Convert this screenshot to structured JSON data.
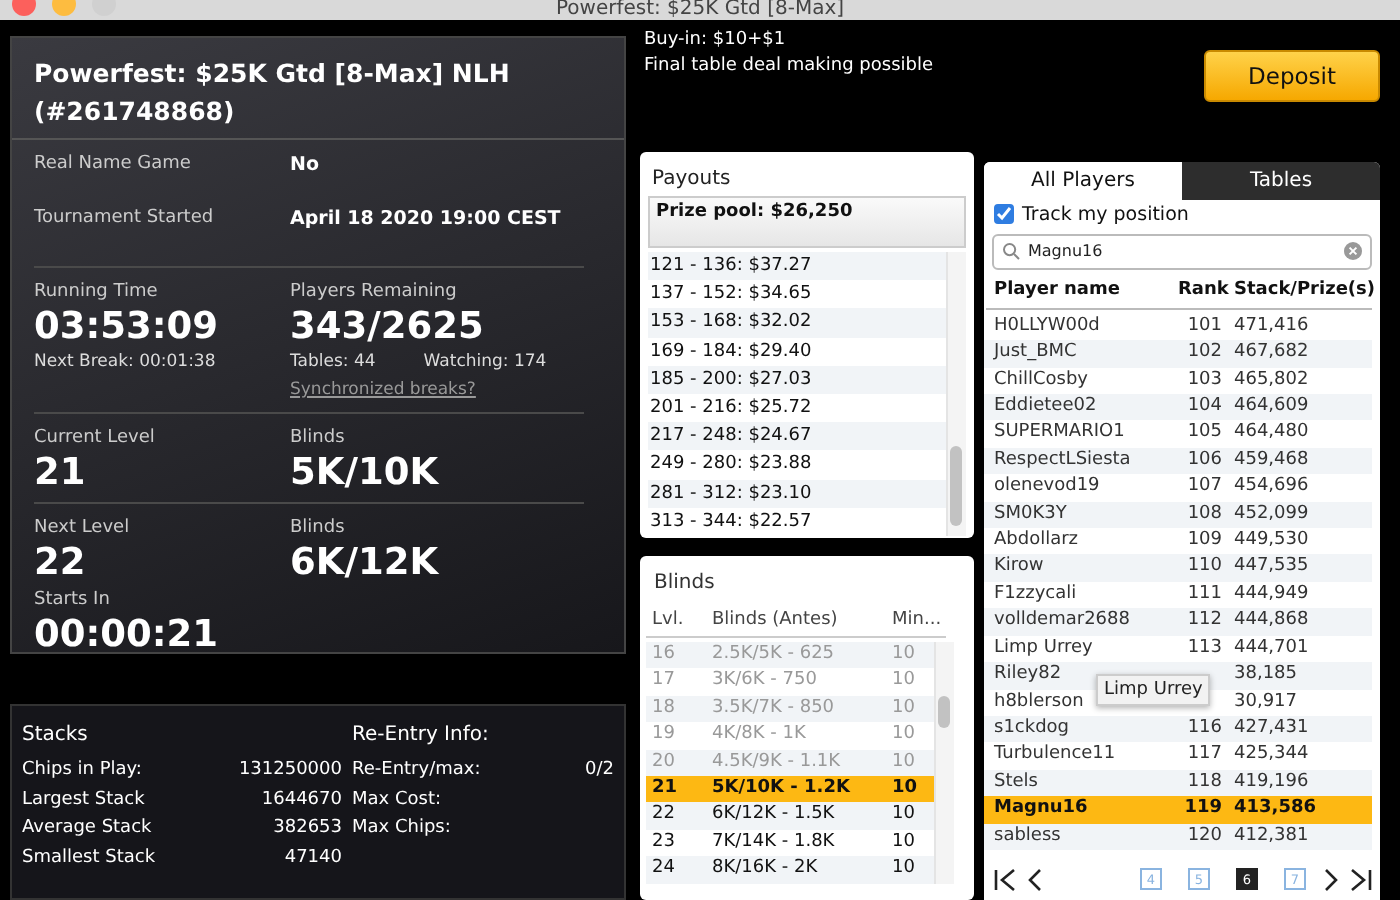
{
  "window": {
    "title": "Powerfest: $25K Gtd [8-Max]"
  },
  "tournament": {
    "title": "Powerfest: $25K Gtd [8-Max] NLH (#261748868)",
    "info": [
      {
        "label": "Real Name Game",
        "value": "No"
      },
      {
        "label": "Tournament Started",
        "value": "April 18 2020 19:00 CEST"
      }
    ],
    "running_time": {
      "label": "Running Time",
      "value": "03:53:09",
      "next_break": "Next Break: 00:01:38"
    },
    "players_remaining": {
      "label": "Players Remaining",
      "value": "343/2625",
      "tables": "Tables: 44",
      "watching": "Watching: 174",
      "link": "Synchronized breaks?"
    },
    "current_level": {
      "label": "Current Level",
      "value": "21",
      "blinds_label": "Blinds",
      "blinds": "5K/10K"
    },
    "next_level": {
      "label": "Next Level",
      "value": "22",
      "blinds_label": "Blinds",
      "blinds": "6K/12K"
    },
    "starts_in": {
      "label": "Starts In",
      "value": "00:00:21"
    }
  },
  "stacks": {
    "title": "Stacks",
    "rows": [
      {
        "label": "Chips in Play:",
        "value": "131250000"
      },
      {
        "label": "Largest Stack",
        "value": "1644670"
      },
      {
        "label": "Average Stack",
        "value": "382653"
      },
      {
        "label": "Smallest Stack",
        "value": "47140"
      }
    ]
  },
  "reentry": {
    "title": "Re-Entry Info:",
    "rows": [
      {
        "label": "Re-Entry/max:",
        "value": "0/2"
      },
      {
        "label": "Max Cost:"
      },
      {
        "label": "Max Chips:"
      }
    ]
  },
  "buy_in": "Buy-in: $10+$1",
  "deal_note": "Final table deal making possible",
  "deposit_button": "Deposit",
  "payouts": {
    "title": "Payouts",
    "prize_pool": "Prize pool: $26,250",
    "rows": [
      "121 - 136: $37.27",
      "137 - 152: $34.65",
      "153 - 168: $32.02",
      "169 - 184: $29.40",
      "185 - 200: $27.03",
      "201 - 216: $25.72",
      "217 - 248: $24.67",
      "249 - 280: $23.88",
      "281 - 312: $23.10",
      "313 - 344: $22.57"
    ]
  },
  "blinds": {
    "title": "Blinds",
    "columns": [
      "Lvl.",
      "Blinds (Antes)",
      "Min..."
    ],
    "rows": [
      {
        "level": "16",
        "blinds": "2.5K/5K - 625",
        "minutes": "10",
        "past": true,
        "selected": false
      },
      {
        "level": "17",
        "blinds": "3K/6K - 750",
        "minutes": "10",
        "past": true,
        "selected": false
      },
      {
        "level": "18",
        "blinds": "3.5K/7K - 850",
        "minutes": "10",
        "past": true,
        "selected": false
      },
      {
        "level": "19",
        "blinds": "4K/8K - 1K",
        "minutes": "10",
        "past": true,
        "selected": false
      },
      {
        "level": "20",
        "blinds": "4.5K/9K - 1.1K",
        "minutes": "10",
        "past": true,
        "selected": false
      },
      {
        "level": "21",
        "blinds": "5K/10K - 1.2K",
        "minutes": "10",
        "past": false,
        "selected": true
      },
      {
        "level": "22",
        "blinds": "6K/12K - 1.5K",
        "minutes": "10",
        "past": false,
        "selected": false
      },
      {
        "level": "23",
        "blinds": "7K/14K - 1.8K",
        "minutes": "10",
        "past": false,
        "selected": false
      },
      {
        "level": "24",
        "blinds": "8K/16K - 2K",
        "minutes": "10",
        "past": false,
        "selected": false
      }
    ]
  },
  "players": {
    "tabs": [
      {
        "label": "All Players",
        "selected": true
      },
      {
        "label": "Tables",
        "selected": false
      }
    ],
    "track": {
      "label": "Track my position",
      "checked": true
    },
    "search": {
      "value": "Magnu16"
    },
    "columns": [
      "Player name",
      "Rank",
      "Stack/Prize(s)"
    ],
    "rows": [
      {
        "name": "H0LLYW00d",
        "rank": "101",
        "stack": "471,416",
        "selected": false
      },
      {
        "name": "Just_BMC",
        "rank": "102",
        "stack": "467,682",
        "selected": false
      },
      {
        "name": "ChillCosby",
        "rank": "103",
        "stack": "465,802",
        "selected": false
      },
      {
        "name": "Eddietee02",
        "rank": "104",
        "stack": "464,609",
        "selected": false
      },
      {
        "name": "SUPERMARIO1",
        "rank": "105",
        "stack": "464,480",
        "selected": false
      },
      {
        "name": "RespectLSiesta",
        "rank": "106",
        "stack": "459,468",
        "selected": false
      },
      {
        "name": "olenevod19",
        "rank": "107",
        "stack": "454,696",
        "selected": false
      },
      {
        "name": "SM0K3Y",
        "rank": "108",
        "stack": "452,099",
        "selected": false
      },
      {
        "name": "Abdollarz",
        "rank": "109",
        "stack": "449,530",
        "selected": false
      },
      {
        "name": "Kirow",
        "rank": "110",
        "stack": "447,535",
        "selected": false
      },
      {
        "name": "F1zzycali",
        "rank": "111",
        "stack": "444,949",
        "selected": false
      },
      {
        "name": "volldemar2688",
        "rank": "112",
        "stack": "444,868",
        "selected": false
      },
      {
        "name": "Limp Urrey",
        "rank": "113",
        "stack": "444,701",
        "selected": false
      },
      {
        "name": "Riley82",
        "stack": "38,185",
        "selected": false
      },
      {
        "name": "h8blerson",
        "stack": "30,917",
        "selected": false
      },
      {
        "name": "s1ckdog",
        "rank": "116",
        "stack": "427,431",
        "selected": false
      },
      {
        "name": "Turbulence11",
        "rank": "117",
        "stack": "425,344",
        "selected": false
      },
      {
        "name": "Stels",
        "rank": "118",
        "stack": "419,196",
        "selected": false
      },
      {
        "name": "Magnu16",
        "rank": "119",
        "stack": "413,586",
        "selected": true
      },
      {
        "name": "sabless",
        "rank": "120",
        "stack": "412,381",
        "selected": false
      }
    ],
    "tooltip": "Limp Urrey",
    "pages": [
      {
        "label": "4",
        "selected": false
      },
      {
        "label": "5",
        "selected": false
      },
      {
        "label": "6",
        "selected": true
      },
      {
        "label": "7",
        "selected": false
      }
    ]
  }
}
